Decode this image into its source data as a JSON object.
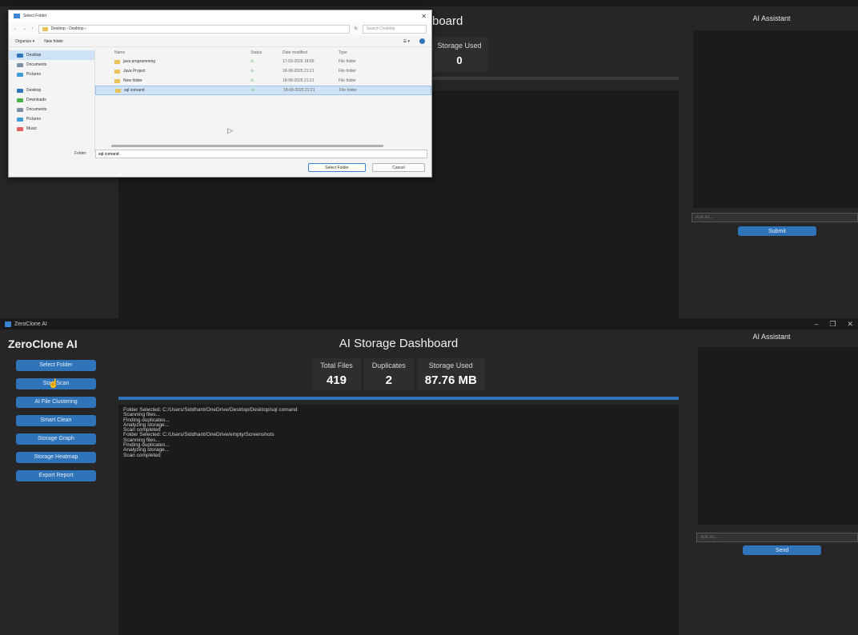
{
  "top": {
    "title_partial": "board",
    "stat_partial": {
      "label": "Storage Used",
      "value": "0"
    },
    "assistant_title": "AI Assistant",
    "ask_placeholder": "Ask AI...",
    "send_label": "Submit",
    "progress": 0.0
  },
  "dialog": {
    "title": "Select Folder",
    "close": "✕",
    "address": "Desktop  ›  Desktop  ›",
    "search_placeholder": "Search Desktop",
    "organize": "Organize ▾",
    "new_folder": "New folder",
    "nav_items": [
      {
        "label": "Desktop",
        "selected": true
      },
      {
        "label": "Documents",
        "selected": false
      },
      {
        "label": "Pictures",
        "selected": false
      },
      {
        "label": "",
        "separator": true
      },
      {
        "label": "Desktop",
        "selected": false
      },
      {
        "label": "Downloads",
        "selected": false
      },
      {
        "label": "Documents",
        "selected": false
      },
      {
        "label": "Pictures",
        "selected": false
      },
      {
        "label": "Music",
        "selected": false
      }
    ],
    "columns": {
      "name": "Name",
      "status": "Status",
      "date": "Date modified",
      "type": "Type"
    },
    "files": [
      {
        "name": "java programming",
        "status": "⊙",
        "date": "17-03-2026 18:56",
        "type": "File folder",
        "selected": false
      },
      {
        "name": "Java Project",
        "status": "⊙",
        "date": "18-08-2025 21:21",
        "type": "File folder",
        "selected": false
      },
      {
        "name": "New folder",
        "status": "⊙",
        "date": "18-08-2025 21:21",
        "type": "File folder",
        "selected": false
      },
      {
        "name": "sql comand",
        "status": "⊙",
        "date": "18-08-2025 21:21",
        "type": "File folder",
        "selected": true
      }
    ],
    "folder_label": "Folder:",
    "folder_value": "sql comand",
    "select_button": "Select Folder",
    "cancel_button": "Cancel"
  },
  "bottom": {
    "window_title": "ZeroClone AI",
    "brand": "ZeroClone AI",
    "sidebar_buttons": [
      "Select Folder",
      "Start Scan",
      "AI File Clustering",
      "Smart Clean",
      "Storage Graph",
      "Storage Heatmap",
      "Export Report"
    ],
    "dashboard_title": "AI Storage Dashboard",
    "stats": [
      {
        "label": "Total Files",
        "value": "419"
      },
      {
        "label": "Duplicates",
        "value": "2"
      },
      {
        "label": "Storage Used",
        "value": "87.76 MB"
      }
    ],
    "progress": 1.0,
    "log_lines": [
      "Folder Selected: C:/Users/Siddhant/OneDrive/Desktop/Desktop/sql comand",
      "Scanning files...",
      "Finding duplicates...",
      "Analyzing storage...",
      "Scan completed",
      "Folder Selected: C:/Users/Siddhant/OneDrive/empty/Screenshots",
      "Scanning files...",
      "Finding duplicates...",
      "Analyzing storage...",
      "Scan completed"
    ],
    "assistant_title": "AI Assistant",
    "ask_placeholder": "Ask AI...",
    "send_label": "Send"
  },
  "colors": {
    "accent": "#2f73b8",
    "background": "#262626",
    "panel": "#1b1b1b"
  }
}
